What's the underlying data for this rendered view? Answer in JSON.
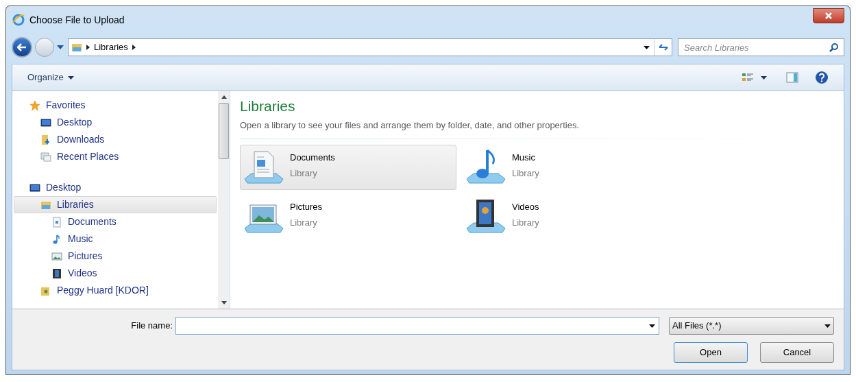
{
  "window": {
    "title": "Choose File to Upload"
  },
  "address": {
    "crumbs": [
      "Libraries"
    ],
    "search_placeholder": "Search Libraries"
  },
  "toolbar": {
    "organize": "Organize"
  },
  "nav_tree": [
    {
      "label": "Favorites",
      "kind": "star",
      "selected": false,
      "children": [
        {
          "label": "Desktop",
          "kind": "desktop",
          "selected": false
        },
        {
          "label": "Downloads",
          "kind": "downloads",
          "selected": false
        },
        {
          "label": "Recent Places",
          "kind": "recent",
          "selected": false
        }
      ]
    },
    {
      "label": "Desktop",
      "kind": "desktop",
      "selected": false,
      "children": [
        {
          "label": "Libraries",
          "kind": "library",
          "selected": true,
          "children": [
            {
              "label": "Documents",
              "kind": "document",
              "selected": false
            },
            {
              "label": "Music",
              "kind": "music",
              "selected": false
            },
            {
              "label": "Pictures",
              "kind": "pictures",
              "selected": false
            },
            {
              "label": "Videos",
              "kind": "videos",
              "selected": false
            }
          ]
        },
        {
          "label": "Peggy Huard [KDOR]",
          "kind": "user",
          "selected": false
        }
      ]
    }
  ],
  "content": {
    "heading": "Libraries",
    "description": "Open a library to see your files and arrange them by folder, date, and other properties.",
    "items": [
      {
        "name": "Documents",
        "type": "Library",
        "kind": "document",
        "selected": true
      },
      {
        "name": "Music",
        "type": "Library",
        "kind": "music",
        "selected": false
      },
      {
        "name": "Pictures",
        "type": "Library",
        "kind": "pictures",
        "selected": false
      },
      {
        "name": "Videos",
        "type": "Library",
        "kind": "videos",
        "selected": false
      }
    ]
  },
  "footer": {
    "file_name_label": "File name:",
    "file_type": "All Files (*.*)",
    "buttons": [
      "Open",
      "Cancel"
    ]
  }
}
